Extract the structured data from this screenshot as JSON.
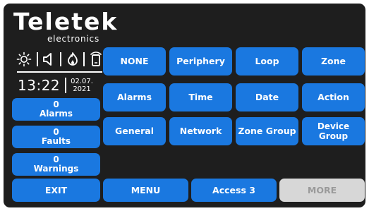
{
  "brand": {
    "name": "Teletek",
    "subtitle": "electronics"
  },
  "status_icons": [
    "sun-icon",
    "speaker-icon",
    "fire-icon",
    "mobile-device-icon"
  ],
  "clock": {
    "time": "13:22",
    "date_day_month": "02.07.",
    "date_year": "2021"
  },
  "counters": [
    {
      "count": "0",
      "label": "Alarms"
    },
    {
      "count": "0",
      "label": "Faults"
    },
    {
      "count": "0",
      "label": "Warnings"
    }
  ],
  "grid": {
    "row1": [
      "NONE",
      "Periphery",
      "Loop",
      "Zone"
    ],
    "row2": [
      "Alarms",
      "Time",
      "Date",
      "Action"
    ],
    "row3": [
      "General",
      "Network",
      "Zone Group",
      "Device Group"
    ]
  },
  "bottom_bar": {
    "exit": "EXIT",
    "menu": "MENU",
    "access": "Access 3",
    "more": "MORE"
  },
  "colors": {
    "button": "#1a78e0",
    "disabled": "#d7d7d7",
    "background": "#1e1e1e"
  }
}
